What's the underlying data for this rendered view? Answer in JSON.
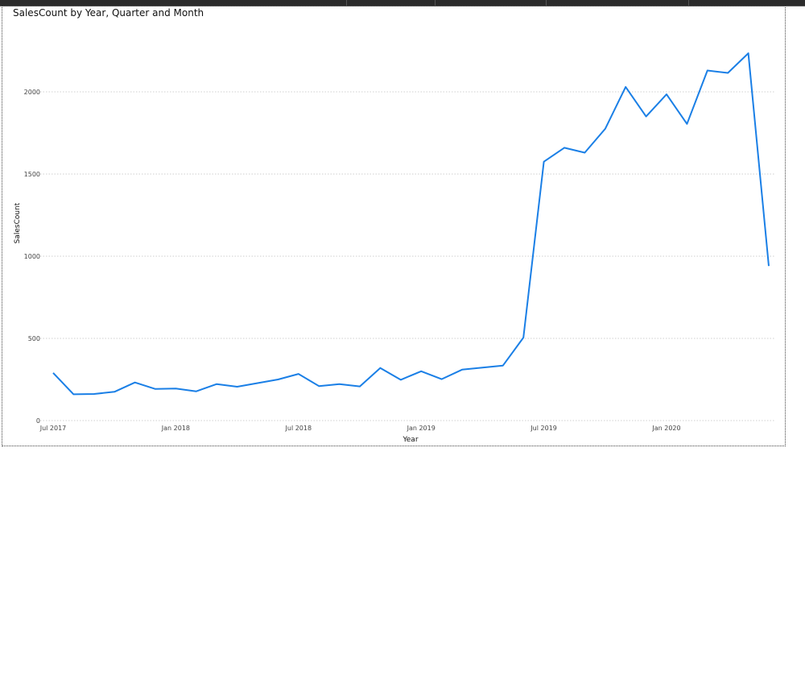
{
  "title": "SalesCount by Year, Quarter and Month",
  "colors": {
    "line": "#1a7fe6",
    "grid": "#cfcfcf"
  },
  "chart_data": {
    "type": "line",
    "title": "SalesCount by Year, Quarter and Month",
    "xlabel": "Year",
    "ylabel": "SalesCount",
    "ylim": [
      0,
      2300
    ],
    "y_ticks": [
      0,
      500,
      1000,
      1500,
      2000
    ],
    "x_tick_labels": [
      "Jul 2017",
      "Jan 2018",
      "Jul 2018",
      "Jan 2019",
      "Jul 2019",
      "Jan 2020"
    ],
    "grid": true,
    "series": [
      {
        "x": [
          "2017-07",
          "2017-08",
          "2017-09",
          "2017-10",
          "2017-11",
          "2017-12",
          "2018-01",
          "2018-02",
          "2018-03",
          "2018-04",
          "2018-05",
          "2018-06",
          "2018-07",
          "2018-08",
          "2018-09",
          "2018-10",
          "2018-11",
          "2018-12",
          "2019-01",
          "2019-02",
          "2019-03",
          "2019-04",
          "2019-05",
          "2019-06",
          "2019-07",
          "2019-08",
          "2019-09",
          "2019-10",
          "2019-11",
          "2019-12",
          "2020-01",
          "2020-02",
          "2020-03",
          "2020-04",
          "2020-05",
          "2020-06"
        ],
        "values": [
          290,
          160,
          162,
          175,
          232,
          192,
          195,
          178,
          222,
          206,
          228,
          250,
          284,
          210,
          222,
          208,
          320,
          248,
          300,
          252,
          310,
          322,
          335,
          505,
          1575,
          1660,
          1630,
          1775,
          2030,
          1850,
          1985,
          1805,
          2130,
          2115,
          2235,
          940
        ]
      }
    ]
  }
}
